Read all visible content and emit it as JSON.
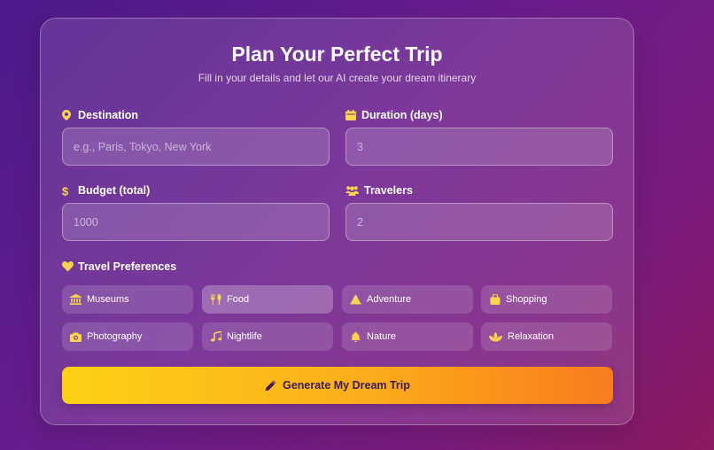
{
  "header": {
    "title": "Plan Your Perfect Trip",
    "subtitle": "Fill in your details and let our AI create your dream itinerary"
  },
  "fields": {
    "destination": {
      "label": "Destination",
      "value": "",
      "placeholder": "e.g., Paris, Tokyo, New York",
      "icon": "map-pin-icon"
    },
    "duration": {
      "label": "Duration (days)",
      "value": "",
      "placeholder": "3",
      "icon": "calendar-icon"
    },
    "budget": {
      "label": "Budget (total)",
      "value": "",
      "placeholder": "1000",
      "icon": "dollar-icon"
    },
    "travelers": {
      "label": "Travelers",
      "value": "",
      "placeholder": "2",
      "icon": "users-icon"
    }
  },
  "preferences": {
    "label": "Travel Preferences",
    "icon": "heart-icon",
    "items": [
      {
        "label": "Museums",
        "icon": "museum-icon",
        "selected": false
      },
      {
        "label": "Food",
        "icon": "utensils-icon",
        "selected": true
      },
      {
        "label": "Adventure",
        "icon": "mountain-icon",
        "selected": false
      },
      {
        "label": "Shopping",
        "icon": "shopping-bag-icon",
        "selected": false
      },
      {
        "label": "Photography",
        "icon": "camera-icon",
        "selected": false
      },
      {
        "label": "Nightlife",
        "icon": "music-icon",
        "selected": false
      },
      {
        "label": "Nature",
        "icon": "leaf-icon",
        "selected": false
      },
      {
        "label": "Relaxation",
        "icon": "spa-icon",
        "selected": false
      }
    ]
  },
  "submit": {
    "label": "Generate My Dream Trip",
    "icon": "pencil-icon"
  },
  "colors": {
    "icon_yellow": "#fcd34d",
    "button_start": "#fcd016",
    "button_end": "#f97c1e",
    "button_text": "#3d1d5c"
  }
}
